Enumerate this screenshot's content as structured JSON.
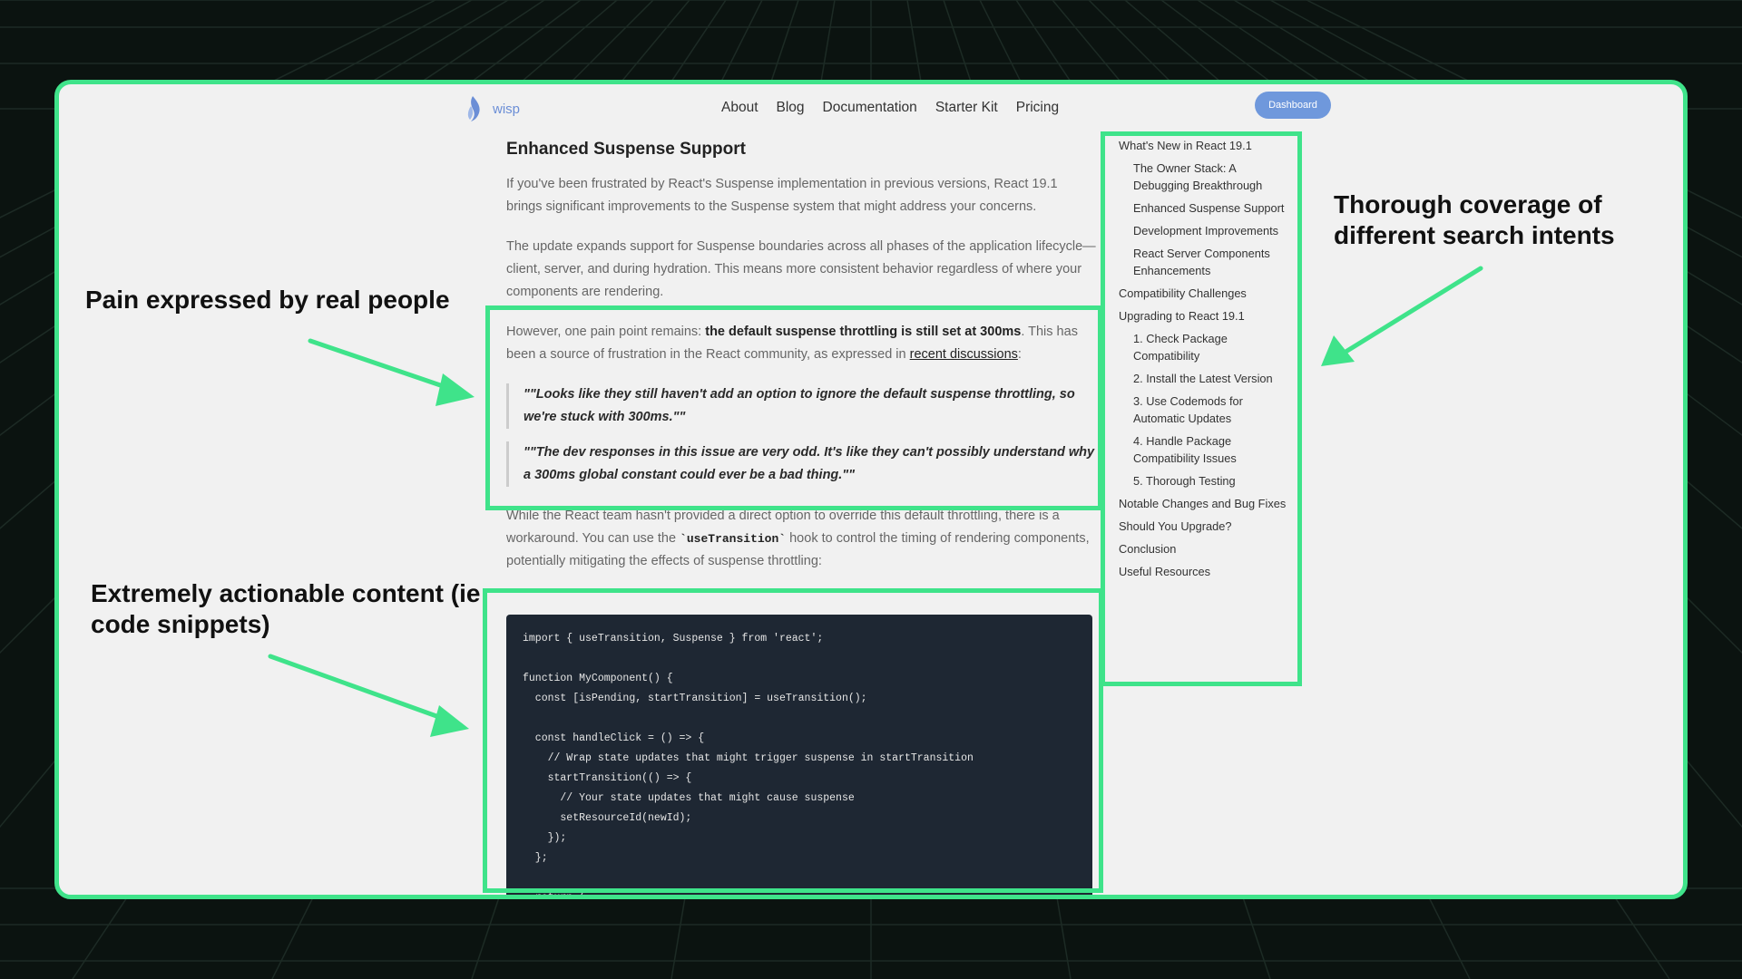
{
  "nav": {
    "logo_text": "wisp",
    "links": [
      "About",
      "Blog",
      "Documentation",
      "Starter Kit",
      "Pricing"
    ],
    "dashboard_button": "Dashboard"
  },
  "article": {
    "heading": "Enhanced Suspense Support",
    "p1": "If you've been frustrated by React's Suspense implementation in previous versions, React 19.1 brings significant improvements to the Suspense system that might address your concerns.",
    "p2": "The update expands support for Suspense boundaries across all phases of the application lifecycle—client, server, and during hydration. This means more consistent behavior regardless of where your components are rendering.",
    "p3_before": "However, one pain point remains: ",
    "p3_strong": "the default suspense throttling is still set at 300ms",
    "p3_after": ". This has been a source of frustration in the React community, as expressed in ",
    "p3_link": "recent discussions",
    "p3_end": ":",
    "quote1": "\"\"Looks like they still haven't add an option to ignore the default suspense throttling, so we're stuck with 300ms.\"\"",
    "quote2": "\"\"The dev responses in this issue are very odd. It's like they can't possibly understand why a 300ms global constant could ever be a bad thing.\"\"",
    "p4_before": "While the React team hasn't provided a direct option to override this default throttling, there is a workaround. You can use the ",
    "p4_code": "`useTransition`",
    "p4_after": " hook to control the timing of rendering components, potentially mitigating the effects of suspense throttling:",
    "code": "import { useTransition, Suspense } from 'react';\n\nfunction MyComponent() {\n  const [isPending, startTransition] = useTransition();\n\n  const handleClick = () => {\n    // Wrap state updates that might trigger suspense in startTransition\n    startTransition(() => {\n      // Your state updates that might cause suspense\n      setResourceId(newId);\n    });\n  };\n\n  return ("
  },
  "toc": [
    {
      "label": "What's New in React 19.1",
      "sub": false
    },
    {
      "label": "The Owner Stack: A Debugging Breakthrough",
      "sub": true
    },
    {
      "label": "Enhanced Suspense Support",
      "sub": true
    },
    {
      "label": "Development Improvements",
      "sub": true
    },
    {
      "label": "React Server Components Enhancements",
      "sub": true
    },
    {
      "label": "Compatibility Challenges",
      "sub": false
    },
    {
      "label": "Upgrading to React 19.1",
      "sub": false
    },
    {
      "label": "1. Check Package Compatibility",
      "sub": true
    },
    {
      "label": "2. Install the Latest Version",
      "sub": true
    },
    {
      "label": "3. Use Codemods for Automatic Updates",
      "sub": true
    },
    {
      "label": "4. Handle Package Compatibility Issues",
      "sub": true
    },
    {
      "label": "5. Thorough Testing",
      "sub": true
    },
    {
      "label": "Notable Changes and Bug Fixes",
      "sub": false
    },
    {
      "label": "Should You Upgrade?",
      "sub": false
    },
    {
      "label": "Conclusion",
      "sub": false
    },
    {
      "label": "Useful Resources",
      "sub": false
    }
  ],
  "annotations": {
    "pain": "Pain expressed by real people",
    "actionable": "Extremely actionable content (ie code snippets)",
    "coverage": "Thorough coverage of different search intents"
  },
  "colors": {
    "accent_green": "#3fe38a",
    "background": "#0b1310",
    "button_blue": "#6f98dc",
    "code_bg": "#1e2733"
  }
}
